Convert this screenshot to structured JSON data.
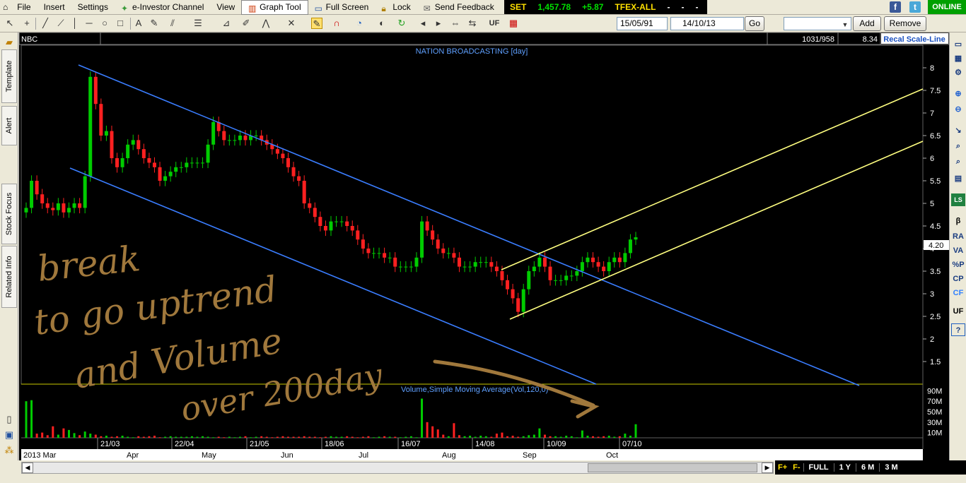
{
  "menu": {
    "items": [
      "File",
      "Insert",
      "Settings",
      "e-Investor Channel",
      "View",
      "Graph Tool",
      "Full Screen",
      "Lock",
      "Send Feedback"
    ]
  },
  "ticker": {
    "set_label": "SET",
    "set_value": "1,457.78",
    "set_change": "+5.87",
    "tfex_label": "TFEX-ALL",
    "tfex_v1": "-",
    "tfex_v2": "-",
    "tfex_v3": "-"
  },
  "online": "ONLINE",
  "toolbar": {
    "start_date": "15/05/91",
    "end_date": "14/10/13",
    "go": "Go",
    "symbol_combo": "",
    "add": "Add",
    "remove": "Remove",
    "uf": "UF"
  },
  "chart_header": {
    "symbol": "NBC",
    "ratio": "1031/958",
    "value": "8.34",
    "recal": "Recal Scale-Line",
    "title": "NATION BROADCASTING [day]"
  },
  "left_tabs": [
    "Template",
    "Alert",
    "Stock Focus",
    "Related Info"
  ],
  "right_tools": [
    "β",
    "RA",
    "VA",
    "%P",
    "CP",
    "CF",
    "UF",
    "?"
  ],
  "price_axis": [
    "8",
    "7.5",
    "7",
    "6.5",
    "6",
    "5.5",
    "5",
    "4.5",
    "4",
    "3.5",
    "3",
    "2.5",
    "2",
    "1.5"
  ],
  "current_price": "4.20",
  "volume_axis": [
    "90M",
    "70M",
    "50M",
    "30M",
    "10M"
  ],
  "volume_label": "Volume,Simple Moving Average(Vol,120,0)",
  "date_labels_top": [
    "21/03",
    "22/04",
    "21/05",
    "18/06",
    "16/07",
    "14/08",
    "10/09",
    "07/10"
  ],
  "month_labels": [
    "2013 Mar",
    "Apr",
    "May",
    "Jun",
    "Jul",
    "Aug",
    "Sep",
    "Oct"
  ],
  "annotation": [
    "break",
    "to go uptrend",
    "and Volume",
    "over 200day"
  ],
  "period_bar": [
    "FULL",
    "1 Y",
    "6 M",
    "3 M"
  ],
  "colors": {
    "up": "#00cc00",
    "down": "#ff2020",
    "channel_down": "#3a7dff",
    "channel_up": "#ffff80",
    "annotation": "#a0783c"
  },
  "chart_data": {
    "type": "candlestick",
    "title": "NATION BROADCASTING [day]",
    "y_range": [
      1,
      8.3
    ],
    "closes": [
      4.9,
      5.5,
      5.2,
      5.0,
      4.9,
      4.85,
      5.0,
      4.8,
      4.9,
      5.0,
      4.9,
      5.6,
      7.8,
      7.2,
      6.5,
      6.6,
      6.0,
      5.8,
      6.0,
      6.3,
      6.4,
      6.2,
      6.0,
      5.9,
      5.8,
      5.5,
      5.6,
      5.7,
      5.8,
      5.8,
      5.9,
      5.9,
      5.9,
      5.9,
      6.3,
      6.8,
      6.6,
      6.4,
      6.4,
      6.4,
      6.5,
      6.4,
      6.5,
      6.5,
      6.4,
      6.3,
      6.2,
      6.1,
      6.0,
      5.8,
      5.6,
      5.5,
      5.0,
      4.9,
      4.7,
      4.5,
      4.4,
      4.6,
      4.6,
      4.6,
      4.5,
      4.4,
      4.2,
      4.0,
      3.9,
      3.9,
      3.9,
      3.8,
      3.8,
      3.6,
      3.6,
      3.6,
      3.6,
      3.8,
      4.6,
      4.4,
      4.2,
      4.0,
      3.9,
      3.9,
      3.8,
      3.6,
      3.6,
      3.6,
      3.7,
      3.7,
      3.7,
      3.6,
      3.5,
      3.3,
      3.1,
      2.9,
      2.6,
      3.1,
      3.5,
      3.6,
      3.8,
      3.6,
      3.3,
      3.3,
      3.3,
      3.4,
      3.4,
      3.5,
      3.7,
      3.8,
      3.7,
      3.6,
      3.5,
      3.7,
      3.8,
      3.7,
      3.9,
      4.2,
      4.25
    ],
    "volumes_M": [
      70,
      72,
      8,
      10,
      5,
      22,
      6,
      18,
      15,
      9,
      5,
      12,
      8,
      6,
      3,
      4,
      2,
      3,
      4,
      2,
      1,
      3,
      2,
      3,
      4,
      1,
      2,
      3,
      2,
      2,
      2,
      3,
      2,
      3,
      2,
      1,
      2,
      1,
      2,
      1,
      2,
      3,
      1,
      2,
      3,
      2,
      1,
      2,
      3,
      2,
      2,
      2,
      3,
      2,
      2,
      1,
      2,
      3,
      2,
      2,
      3,
      2,
      1,
      2,
      3,
      1,
      2,
      3,
      2,
      2,
      1,
      2,
      3,
      1,
      75,
      30,
      22,
      16,
      6,
      3,
      28,
      5,
      3,
      4,
      2,
      4,
      3,
      2,
      8,
      10,
      3,
      4,
      2,
      3,
      5,
      6,
      18,
      6,
      3,
      3,
      2,
      4,
      3,
      1,
      14,
      4,
      3,
      2,
      3,
      4,
      2,
      3,
      8,
      4,
      26
    ],
    "volume_range_M": [
      0,
      100
    ],
    "date_ticks": [
      "21/03",
      "22/04",
      "21/05",
      "18/06",
      "16/07",
      "14/08",
      "10/09",
      "07/10"
    ],
    "months": [
      "2013 Mar",
      "Apr",
      "May",
      "Jun",
      "Jul",
      "Aug",
      "Sep",
      "Oct"
    ]
  }
}
